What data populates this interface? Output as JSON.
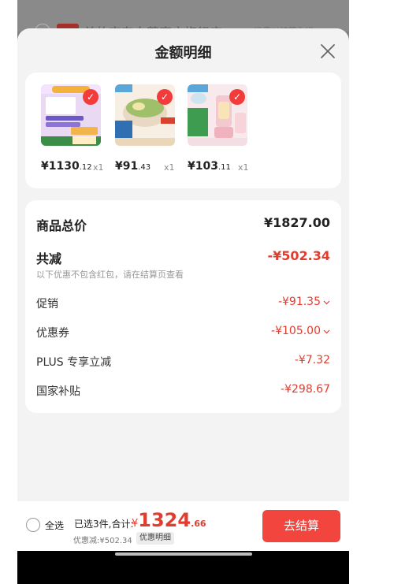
{
  "background": {
    "shop_name": "美的京东自营官方旗舰店",
    "shop_hint": "运费以结算为准"
  },
  "sheet": {
    "title": "金额明细",
    "close_icon": "close-icon"
  },
  "products": [
    {
      "price_int": "¥1130",
      "price_dec": ".12",
      "qty": "x1"
    },
    {
      "price_int": "¥91",
      "price_dec": ".43",
      "qty": "x1"
    },
    {
      "price_int": "¥103",
      "price_dec": ".11",
      "qty": "x1"
    }
  ],
  "summary": {
    "total_label": "商品总价",
    "total_value": "¥1827.00",
    "reduce_label": "共减",
    "reduce_value": "-¥502.34",
    "reduce_note": "以下优惠不包含红包，请在结算页查看",
    "promo_label": "促销",
    "promo_value": "-¥91.35",
    "coupon_label": "优惠券",
    "coupon_value": "-¥105.00",
    "plus_label": "PLUS 专享立减",
    "plus_value": "-¥7.32",
    "subsidy_label": "国家补贴",
    "subsidy_value": "-¥298.67"
  },
  "footer": {
    "select_all": "全选",
    "selected_count": "已选3件,合计:",
    "total_yen": "¥",
    "total_int": "1324",
    "total_dec": ".66",
    "discount": "优惠减:¥502.34",
    "detail_button": "优惠明细",
    "checkout_button": "去结算"
  },
  "colors": {
    "accent_red": "#e23c2e",
    "checkout_red": "#f2453d"
  }
}
